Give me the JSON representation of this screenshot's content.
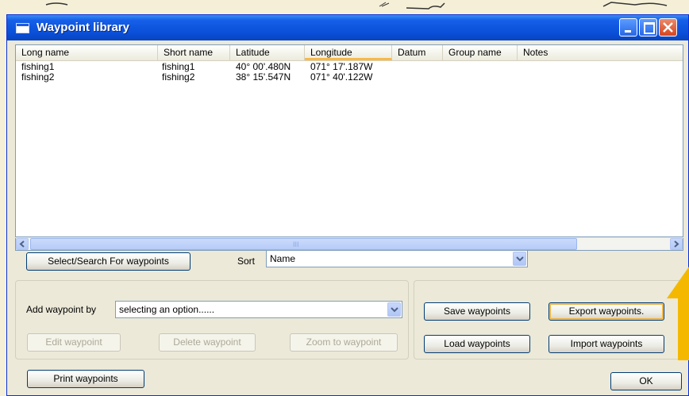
{
  "window": {
    "title": "Waypoint library"
  },
  "list": {
    "columns": [
      "Long name",
      "Short name",
      "Latitude",
      "Longitude",
      "Datum",
      "Group name",
      "Notes"
    ],
    "rows": [
      [
        "fishing1",
        "fishing1",
        "40° 00'.480N",
        "071° 17'.187W",
        "",
        "",
        ""
      ],
      [
        "fishing2",
        "fishing2",
        "38° 15'.547N",
        "071° 40'.122W",
        "",
        "",
        ""
      ]
    ],
    "scroll_grip": "III"
  },
  "search": {
    "button_label": "Select/Search For waypoints"
  },
  "sort": {
    "label": "Sort",
    "value": "Name"
  },
  "add": {
    "label": "Add waypoint by",
    "value": "selecting an option......",
    "edit_label": "Edit waypoint",
    "delete_label": "Delete waypoint",
    "zoom_label": "Zoom to waypoint"
  },
  "file": {
    "save_label": "Save waypoints",
    "export_label": "Export waypoints.",
    "load_label": "Load waypoints",
    "import_label": "Import waypoints"
  },
  "footer": {
    "print_label": "Print waypoints",
    "ok_label": "OK"
  },
  "colors": {
    "titlebar": "#0a4fd8",
    "dialog_bg": "#ece9d8",
    "highlight_arrow": "#f5b800"
  },
  "icons": {
    "window": "window-icon",
    "minimize": "minimize-icon",
    "maximize": "maximize-icon",
    "close": "close-icon",
    "dropdown": "chevron-down-icon"
  }
}
